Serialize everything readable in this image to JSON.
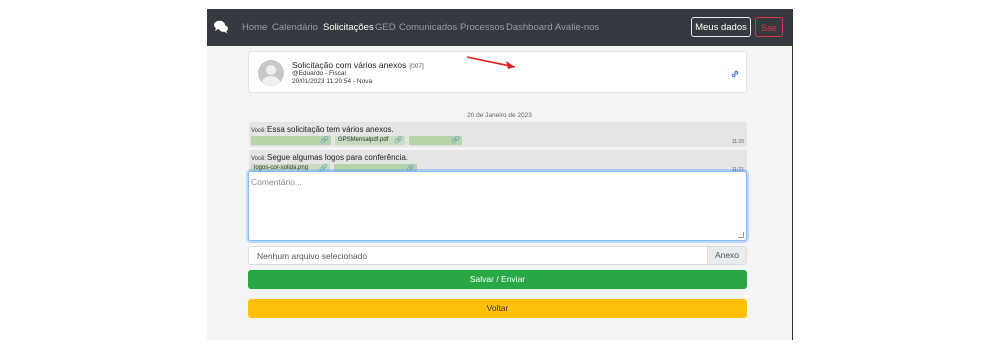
{
  "nav": {
    "items": [
      "Home",
      "Calendário",
      "Solicitações",
      "GED",
      "Comunicados",
      "Processos",
      "Dashboard",
      "Avalie-nos"
    ],
    "active": "Solicitações",
    "meus_dados": "Meus dados",
    "sair": "Sair"
  },
  "request": {
    "title": "Solicitação com vários anexos",
    "id": "[007]",
    "user": "@Eduardo - Fiscal",
    "meta": "20/01/2023 11:20:54 - Nova"
  },
  "thread": {
    "date": "20 de Janeiro de 2023",
    "messages": [
      {
        "who": "Você:",
        "text": "Essa solicitação tem vários anexos.",
        "attachments": [
          "",
          "GPSMensalpdf.pdf",
          ""
        ],
        "time": "11:20"
      },
      {
        "who": "Você:",
        "text": "Segue algumas logos para conferência.",
        "attachments": [
          "logos-cor-solida.png",
          ""
        ],
        "time": "11:21"
      }
    ]
  },
  "form": {
    "comment_placeholder": "Comentário...",
    "file_placeholder": "Nenhum arquivo selecionado",
    "file_button": "Anexo",
    "save_label": "Salvar / Enviar",
    "back_label": "Voltar"
  },
  "colors": {
    "navbar": "#343a40",
    "save": "#28a745",
    "back": "#ffc107",
    "danger": "#dc3545",
    "annotation_arrow": "#e02020"
  }
}
